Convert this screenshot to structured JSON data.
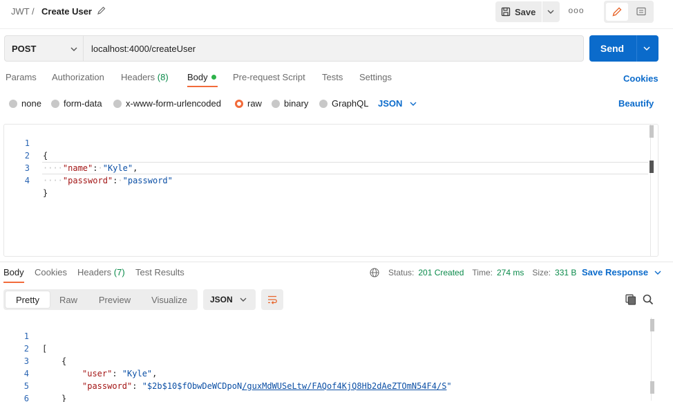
{
  "header": {
    "workspace": "JWT",
    "separator": "/",
    "request_name": "Create User",
    "save_label": "Save",
    "more_label": "ooo"
  },
  "request": {
    "method": "POST",
    "url": "localhost:4000/createUser",
    "send_label": "Send"
  },
  "request_tabs": [
    {
      "label": "Params"
    },
    {
      "label": "Authorization"
    },
    {
      "label": "Headers",
      "count": "(8)"
    },
    {
      "label": "Body"
    },
    {
      "label": "Pre-request Script"
    },
    {
      "label": "Tests"
    },
    {
      "label": "Settings"
    }
  ],
  "cookies_label": "Cookies",
  "body_types": [
    "none",
    "form-data",
    "x-www-form-urlencoded",
    "raw",
    "binary",
    "GraphQL"
  ],
  "body_language": "JSON",
  "beautify_label": "Beautify",
  "request_body": {
    "line_numbers": [
      "1",
      "2",
      "3",
      "4"
    ],
    "open": "{",
    "k1": "\"name\"",
    "v1": "\"Kyle\"",
    "k2": "\"password\"",
    "v2": "\"password\"",
    "close": "}"
  },
  "response_tabs": [
    {
      "label": "Body"
    },
    {
      "label": "Cookies"
    },
    {
      "label": "Headers",
      "count": "(7)"
    },
    {
      "label": "Test Results"
    }
  ],
  "response_status": {
    "status_label": "Status:",
    "status_value": "201 Created",
    "time_label": "Time:",
    "time_value": "274 ms",
    "size_label": "Size:",
    "size_value": "331 B"
  },
  "save_response_label": "Save Response",
  "view_modes": [
    "Pretty",
    "Raw",
    "Preview",
    "Visualize"
  ],
  "response_format": "JSON",
  "response_body": {
    "line_numbers": [
      "1",
      "2",
      "3",
      "4",
      "5",
      "6"
    ],
    "open_arr": "[",
    "open_obj": "{",
    "k1": "\"user\"",
    "v1": "\"Kyle\"",
    "k2": "\"password\"",
    "v2_a": "\"$2b$10$fObwDeWCDpoN",
    "v2_b": "/guxMdWUSeLtw/FAQof4KjQ8Hb2dAeZTOmN54F4/S",
    "v2_c": "\"",
    "close_obj": "}",
    "close_arr": "]"
  },
  "colors": {
    "accent_blue": "#0b6bcb",
    "active_tab_orange": "#f26b3a",
    "status_green": "#0a8a4a",
    "body_dot_green": "#2eb24a"
  }
}
